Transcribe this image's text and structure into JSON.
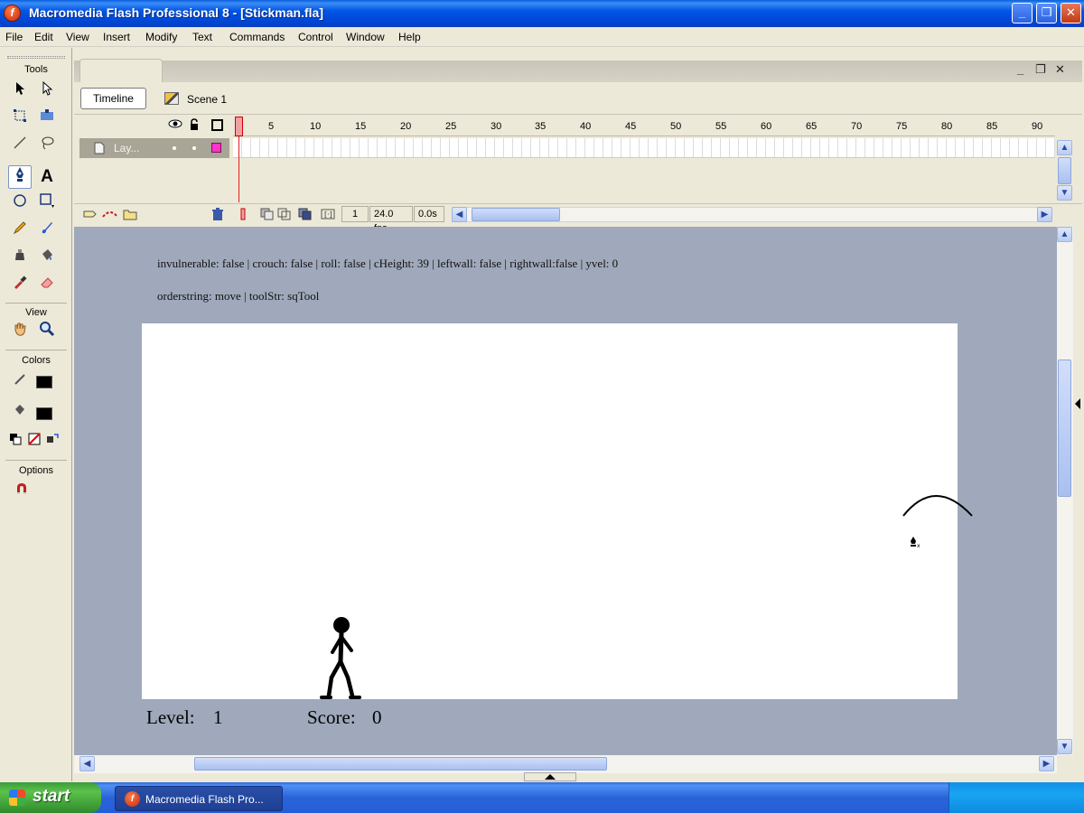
{
  "window": {
    "title": "Macromedia Flash Professional 8 - [Stickman.fla]",
    "app_icon": "flash-icon",
    "controls": [
      "minimize-icon",
      "restore-icon",
      "close-icon"
    ]
  },
  "menu": [
    "File",
    "Edit",
    "View",
    "Insert",
    "Modify",
    "Text",
    "Commands",
    "Control",
    "Window",
    "Help"
  ],
  "tools": {
    "title": "Tools",
    "view_label": "View",
    "colors_label": "Colors",
    "options_label": "Options",
    "text_tool_glyph": "A",
    "selected_tool": "pen-icon"
  },
  "doc_controls": {
    "minimize": "_",
    "restore": "❐",
    "close": "✕"
  },
  "edit_bar": {
    "timeline_button": "Timeline",
    "scene_label": "Scene 1"
  },
  "timeline": {
    "layer_name": "Lay...",
    "frame_ticks": [
      "1",
      "5",
      "10",
      "15",
      "20",
      "25",
      "30",
      "35",
      "40",
      "45",
      "50",
      "55",
      "60",
      "65",
      "70",
      "75",
      "80",
      "85",
      "90"
    ],
    "current_frame": "1",
    "frame_rate": "24.0 fps",
    "elapsed_time": "0.0s"
  },
  "stage": {
    "status_line_1": "invulnerable: false | crouch: false | roll: false | cHeight: 39 | leftwall: false | rightwall:false | yvel: 0",
    "status_line_2": "orderstring: move | toolStr: sqTool",
    "level_label": "Level:",
    "level_value": "1",
    "score_label": "Score:",
    "score_value": "0"
  },
  "taskbar": {
    "start_label": "start",
    "task_label": "Macromedia Flash Pro..."
  },
  "colors": {
    "titlebar": "#0055e5",
    "stage_background": "#ffffff",
    "pasteboard": "#9fa9bb",
    "playhead": "#e02020",
    "layer_color": "#ff33cc"
  }
}
